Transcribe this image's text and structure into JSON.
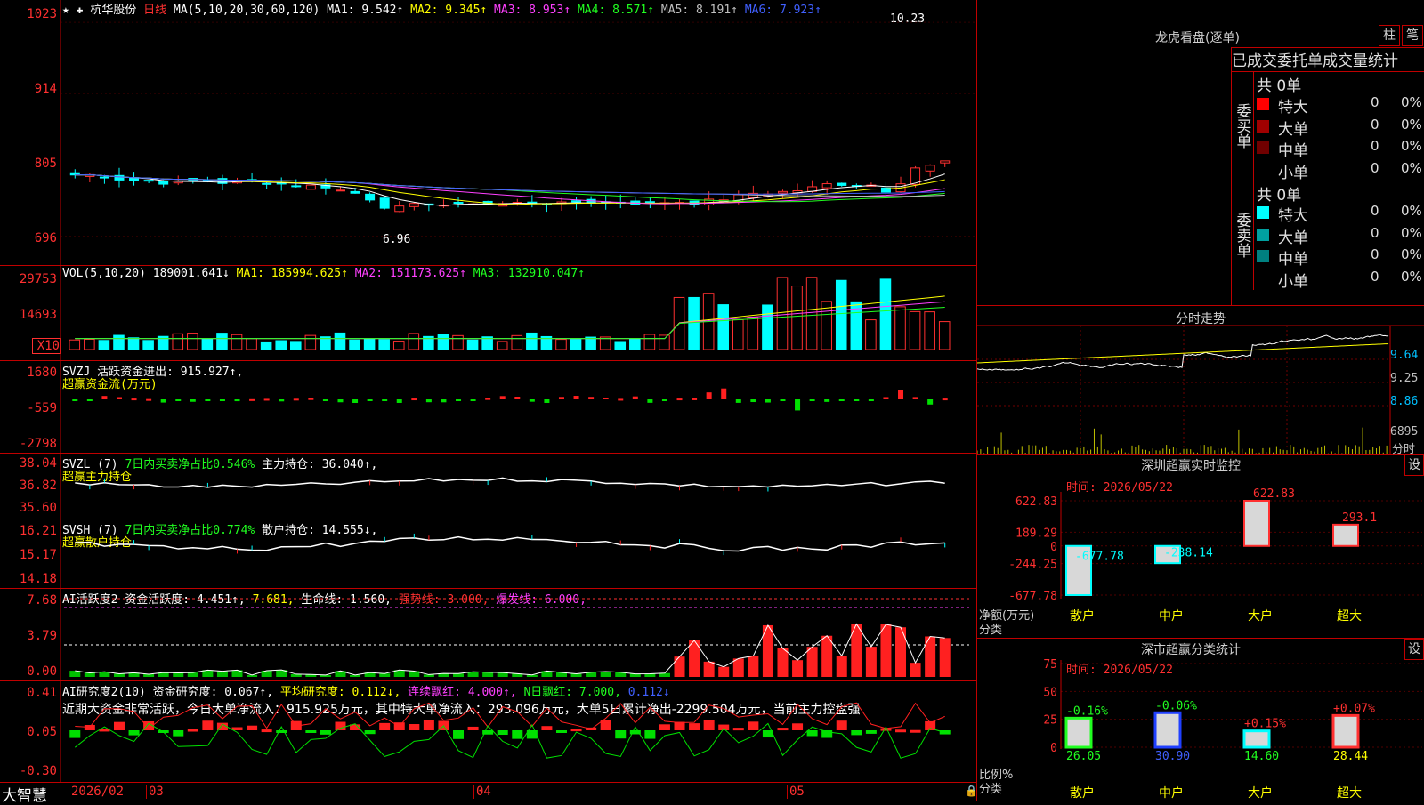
{
  "kline": {
    "icons": "★ ✚",
    "stock_name": "杭华股份",
    "period": "日线",
    "ma_label": "MA(5,10,20,30,60,120)",
    "ma_values": [
      "MA1: 9.542↑",
      "MA2: 9.345↑",
      "MA3: 8.953↑",
      "MA4: 8.571↑",
      "MA5: 8.191↑",
      "MA6: 7.923↑"
    ],
    "y_ticks": [
      "1023",
      "914",
      "805",
      "696"
    ],
    "high_mark": "10.23",
    "low_mark": "6.96"
  },
  "volume": {
    "label": "VOL(5,10,20)",
    "value": "189001.641↓",
    "ma_values": [
      "MA1: 185994.625↑",
      "MA2: 151173.625↑",
      "MA3: 132910.047↑"
    ],
    "y_ticks": [
      "29753",
      "14693",
      "X10"
    ]
  },
  "svzj": {
    "label": "SVZJ  活跃资金进出: 915.927↑,",
    "subtitle": "超赢资金流(万元)",
    "y_ticks": [
      "1680",
      "-559",
      "-2798"
    ]
  },
  "svzl": {
    "label": "SVZL (7)",
    "pct": "7日内买卖净占比0.546%",
    "hold": "主力持仓: 36.040↑,",
    "subtitle": "超赢主力持仓",
    "y_ticks": [
      "38.04",
      "36.82",
      "35.60"
    ]
  },
  "svsh": {
    "label": "SVSH (7)",
    "pct": "7日内买卖净占比0.774%",
    "hold": "散户持仓: 14.555↓,",
    "subtitle": "超赢散户持仓",
    "y_ticks": [
      "16.21",
      "15.17",
      "14.18"
    ]
  },
  "ai_active": {
    "label": "AI活跃度2 资金活跃度: 4.451↑,",
    "v2": "7.681,",
    "v3": "生命线: 1.560,",
    "v4": "强势线: 3.000,",
    "v5": "爆发线: 6.000,",
    "y_ticks": [
      "7.68",
      "3.79",
      "0.00"
    ]
  },
  "ai_research": {
    "label": "AI研究度2(10) 资金研究度: 0.067↑,",
    "v2": "平均研究度: 0.112↓,",
    "v3": "连续飘红: 4.000↑,",
    "v4": "N日飘红: 7.000,",
    "v5": "0.112↓",
    "summary": "近期大资金非常活跃，今日大单净流入：915.925万元，其中特大单净流入：293.096万元，大单5日累计净出-2299.504万元，当前主力控盘强",
    "y_ticks": [
      "0.41",
      "0.05",
      "-0.30"
    ]
  },
  "footer": {
    "brand": "大智慧",
    "date": "2026/02",
    "months": [
      "03",
      "04",
      "05"
    ]
  },
  "lhb": {
    "title": "龙虎看盘(逐单)",
    "btn_zhu": "柱",
    "btn_bi": "笔",
    "tabs": [
      "已成交",
      "委托单",
      "成交量",
      "统计"
    ],
    "buy_label": "委买单",
    "sell_label": "委卖单",
    "buy_total": "共 0单",
    "sell_total": "共 0单",
    "buy_rows": [
      {
        "name": "特大",
        "count": "0",
        "pct": "0%",
        "color": "#ff0000"
      },
      {
        "name": "大单",
        "count": "0",
        "pct": "0%",
        "color": "#a00000"
      },
      {
        "name": "中单",
        "count": "0",
        "pct": "0%",
        "color": "#700000"
      },
      {
        "name": "小单",
        "count": "0",
        "pct": "0%",
        "color": ""
      }
    ],
    "sell_rows": [
      {
        "name": "特大",
        "count": "0",
        "pct": "0%",
        "color": "#00ffff"
      },
      {
        "name": "大单",
        "count": "0",
        "pct": "0%",
        "color": "#00a0a0"
      },
      {
        "name": "中单",
        "count": "0",
        "pct": "0%",
        "color": "#008080"
      },
      {
        "name": "小单",
        "count": "0",
        "pct": "0%",
        "color": ""
      }
    ]
  },
  "intraday": {
    "title": "分时走势",
    "y_ticks": [
      "9.64",
      "9.25",
      "8.86"
    ],
    "vol": "6895",
    "vol_label": "分时"
  },
  "monitor": {
    "title": "深圳超赢实时监控",
    "btn": "设",
    "time": "时间: 2026/05/22",
    "y_ticks": [
      "622.83",
      "189.29",
      "0",
      "-244.25",
      "-677.78"
    ],
    "unit": "净额(万元)",
    "cat_label": "分类",
    "categories": [
      "散户",
      "中户",
      "大户",
      "超大"
    ],
    "values": [
      -677.78,
      -238.14,
      622.83,
      293.1
    ],
    "value_labels": [
      "-677.78",
      "-238.14",
      "622.83",
      "293.1"
    ]
  },
  "classify": {
    "title": "深市超赢分类统计",
    "btn": "设",
    "time": "时间: 2026/05/22",
    "y_ticks": [
      "75",
      "50",
      "25",
      "0"
    ],
    "unit": "比例%",
    "cat_label": "分类",
    "categories": [
      "散户",
      "中户",
      "大户",
      "超大"
    ],
    "values": [
      26.05,
      30.9,
      14.6,
      28.44
    ],
    "value_labels": [
      "26.05",
      "30.90",
      "14.60",
      "28.44"
    ],
    "changes": [
      "-0.16%",
      "-0.06%",
      "+0.15%",
      "+0.07%"
    ]
  }
}
